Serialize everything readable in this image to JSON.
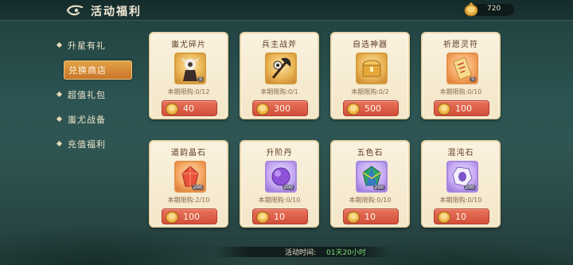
{
  "header": {
    "title": "活动福利",
    "currency": {
      "icon": "gold-coin-icon",
      "value": "720"
    }
  },
  "sidebar": {
    "items": [
      {
        "label": "升星有礼",
        "active": false
      },
      {
        "label": "兑换商店",
        "active": true
      },
      {
        "label": "超值礼包",
        "active": false
      },
      {
        "label": "蚩尤战备",
        "active": false
      },
      {
        "label": "充值福利",
        "active": false
      }
    ]
  },
  "shop": {
    "items": [
      {
        "name": "蚩尤碎片",
        "icon": "chiyou-shard-icon",
        "badge": "S",
        "limit": "本期限购:0/12",
        "price": "40"
      },
      {
        "name": "兵主战斧",
        "icon": "war-axe-icon",
        "badge": "",
        "limit": "本期限购:0/1",
        "price": "300"
      },
      {
        "name": "自选神器",
        "icon": "artifact-chest-icon",
        "badge": "",
        "limit": "本期限购:0/2",
        "price": "500"
      },
      {
        "name": "祈愿灵符",
        "icon": "prayer-talisman-icon",
        "badge": "S",
        "limit": "本期限购:0/10",
        "price": "100"
      },
      {
        "name": "道韵晶石",
        "icon": "crystal-ore-icon",
        "badge": "200",
        "limit": "本期限购:2/10",
        "price": "100"
      },
      {
        "name": "升阶丹",
        "icon": "pill-orb-icon",
        "badge": "200",
        "limit": "本期限购:0/10",
        "price": "10"
      },
      {
        "name": "五色石",
        "icon": "five-color-stone-icon",
        "badge": "200",
        "limit": "本期限购:0/10",
        "price": "10"
      },
      {
        "name": "混沌石",
        "icon": "chaos-stone-icon",
        "badge": "200",
        "limit": "本期限购:0/10",
        "price": "10"
      }
    ]
  },
  "footer": {
    "timer_label": "活动时间:",
    "timer_value": "01天20小时"
  },
  "colors": {
    "accent": "#d9893a",
    "buy_button": "#d24f3a",
    "timer_value": "#7ee07b"
  }
}
